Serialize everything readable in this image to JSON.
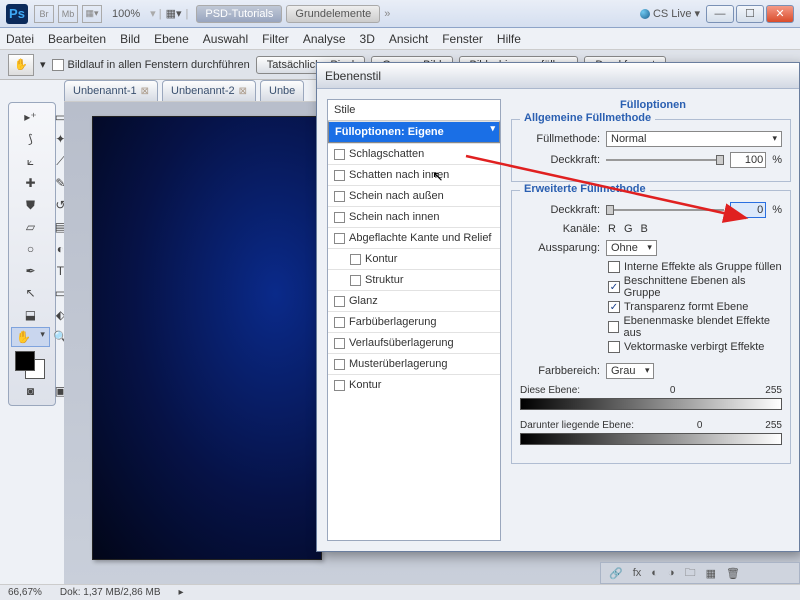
{
  "app": {
    "ps": "Ps",
    "icons": [
      "Br",
      "Mb"
    ],
    "zoom": "100%",
    "mid1": "PSD-Tutorials",
    "mid2": "Grundelemente",
    "cslive": "CS Live"
  },
  "menu": [
    "Datei",
    "Bearbeiten",
    "Bild",
    "Ebene",
    "Auswahl",
    "Filter",
    "Analyse",
    "3D",
    "Ansicht",
    "Fenster",
    "Hilfe"
  ],
  "opt": {
    "scroll_all": "Bildlauf in allen Fenstern durchführen",
    "b1": "Tatsächliche Pixel",
    "b2": "Ganzes Bild",
    "b3": "Bildschirm ausfüllen",
    "b4": "Druckformat"
  },
  "tabs": [
    "Unbenannt-1",
    "Unbenannt-2",
    "Unbe"
  ],
  "dialog": {
    "title": "Ebenenstil",
    "list_header": "Stile",
    "items": [
      {
        "label": "Fülloptionen: Eigene",
        "sel": true,
        "cb": false
      },
      {
        "label": "Schlagschatten",
        "cb": true
      },
      {
        "label": "Schatten nach innen",
        "cb": true
      },
      {
        "label": "Schein nach außen",
        "cb": true
      },
      {
        "label": "Schein nach innen",
        "cb": true
      },
      {
        "label": "Abgeflachte Kante und Relief",
        "cb": true
      },
      {
        "label": "Kontur",
        "cb": true,
        "indent": true
      },
      {
        "label": "Struktur",
        "cb": true,
        "indent": true
      },
      {
        "label": "Glanz",
        "cb": true
      },
      {
        "label": "Farbüberlagerung",
        "cb": true
      },
      {
        "label": "Verlaufsüberlagerung",
        "cb": true
      },
      {
        "label": "Musterüberlagerung",
        "cb": true
      },
      {
        "label": "Kontur",
        "cb": true
      }
    ],
    "fill_heading": "Fülloptionen",
    "gen_group": "Allgemeine Füllmethode",
    "blendmode_label": "Füllmethode:",
    "blendmode_value": "Normal",
    "opacity_label": "Deckkraft:",
    "opacity_value": "100",
    "adv_group": "Erweiterte Füllmethode",
    "fillopacity_label": "Deckkraft:",
    "fillopacity_value": "0",
    "channels_label": "Kanäle:",
    "ch_r": "R",
    "ch_g": "G",
    "ch_b": "B",
    "knockout_label": "Aussparung:",
    "knockout_value": "Ohne",
    "flags": [
      {
        "label": "Interne Effekte als Gruppe füllen",
        "on": false
      },
      {
        "label": "Beschnittene Ebenen als Gruppe",
        "on": true
      },
      {
        "label": "Transparenz formt Ebene",
        "on": true
      },
      {
        "label": "Ebenenmaske blendet Effekte aus",
        "on": false
      },
      {
        "label": "Vektormaske verbirgt Effekte",
        "on": false
      }
    ],
    "blendif_label": "Farbbereich:",
    "blendif_value": "Grau",
    "this_layer": "Diese Ebene:",
    "this_lo": "0",
    "this_hi": "255",
    "under_layer": "Darunter liegende Ebene:",
    "under_lo": "0",
    "under_hi": "255"
  },
  "status": {
    "zoom": "66,67%",
    "doc": "Dok: 1,37 MB/2,86 MB"
  }
}
